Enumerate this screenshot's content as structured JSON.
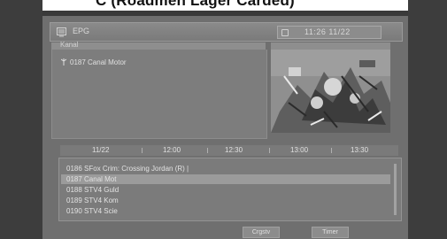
{
  "caption": "C (Roadmen Lager Carded)",
  "header": {
    "title": "EPG",
    "clock": "11:26 11/22"
  },
  "channel_panel": {
    "tab_label": "Kanal",
    "current_channel": "0187 Canal Motor"
  },
  "timeline": {
    "ticks": [
      "11/22",
      "12:00",
      "12:30",
      "13:00",
      "13:30"
    ]
  },
  "programs": [
    {
      "text": "0186 SFox Crim: Crossing Jordan (R) |",
      "selected": false
    },
    {
      "text": "0187 Canal Mot",
      "selected": true
    },
    {
      "text": "0188 STV4 Guld",
      "selected": false
    },
    {
      "text": "0189 STV4 Kom",
      "selected": false
    },
    {
      "text": "0190 STV4 Scie",
      "selected": false
    }
  ],
  "footer": {
    "button_1": "Crgstv",
    "button_2": "Timer"
  },
  "colors": {
    "frame": "#3d3d3d",
    "screen": "#6f6f6f",
    "panel": "#7d7d7d",
    "highlight": "#9b9b9b"
  }
}
